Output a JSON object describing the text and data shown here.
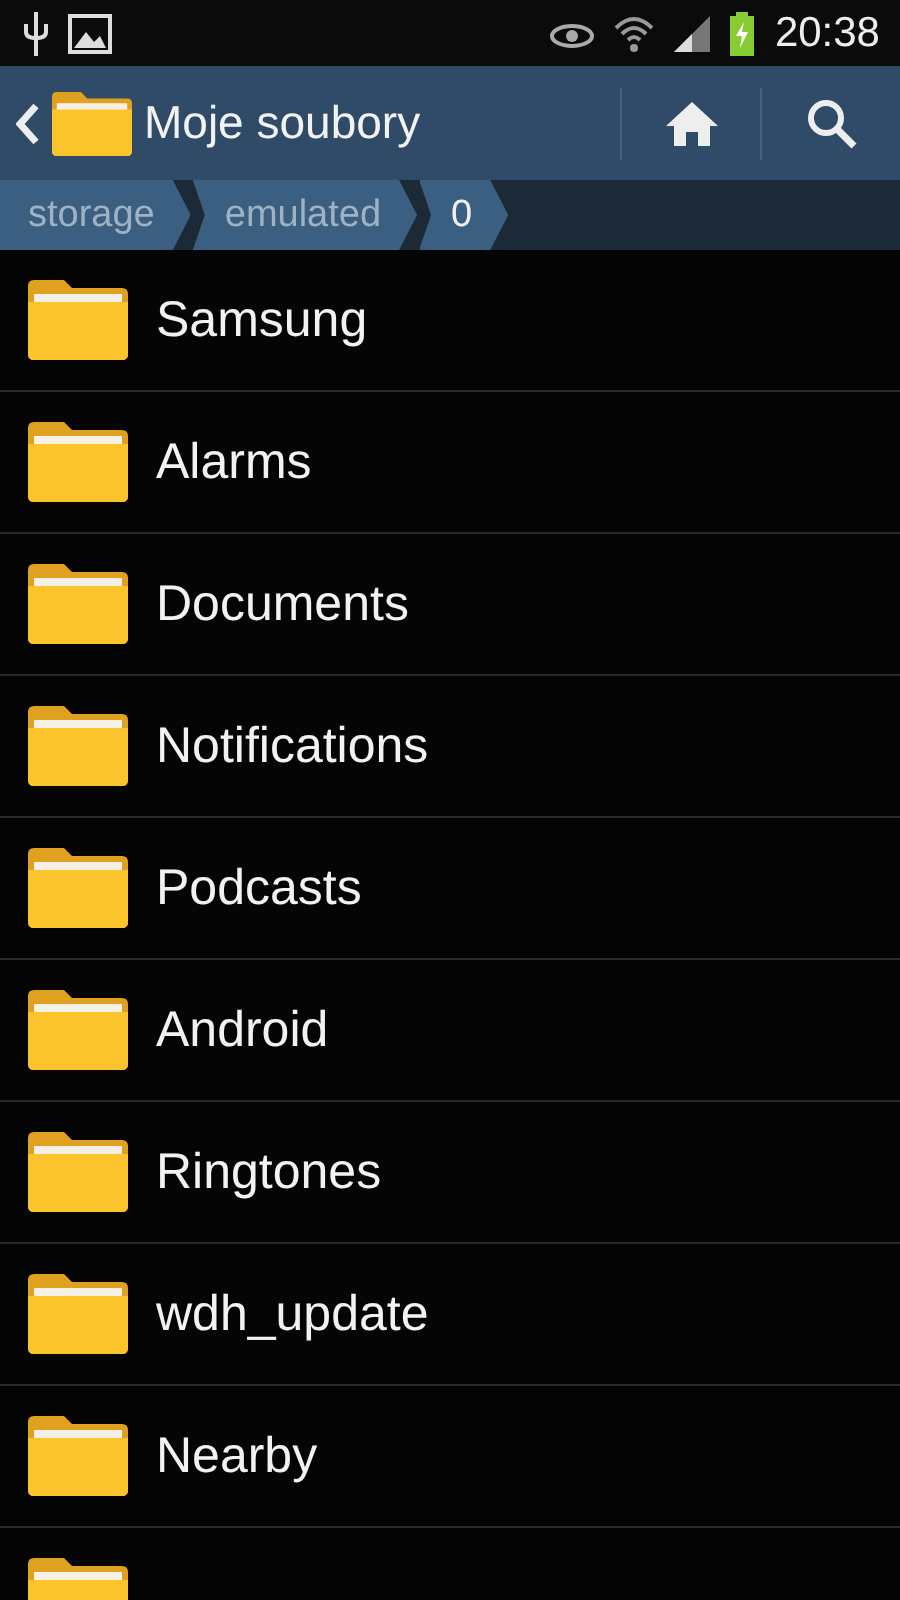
{
  "status_bar": {
    "time": "20:38"
  },
  "action_bar": {
    "title": "Moje soubory"
  },
  "breadcrumbs": [
    {
      "label": "storage",
      "selected": false
    },
    {
      "label": "emulated",
      "selected": false
    },
    {
      "label": "0",
      "selected": true
    }
  ],
  "folders": [
    {
      "kind": "folder",
      "name": "Samsung"
    },
    {
      "kind": "folder",
      "name": "Alarms"
    },
    {
      "kind": "folder",
      "name": "Documents"
    },
    {
      "kind": "folder",
      "name": "Notifications"
    },
    {
      "kind": "folder",
      "name": "Podcasts"
    },
    {
      "kind": "folder",
      "name": "Android"
    },
    {
      "kind": "folder",
      "name": "Ringtones"
    },
    {
      "kind": "folder",
      "name": "wdh_update"
    },
    {
      "kind": "folder",
      "name": "Nearby"
    },
    {
      "kind": "folder"
    }
  ]
}
